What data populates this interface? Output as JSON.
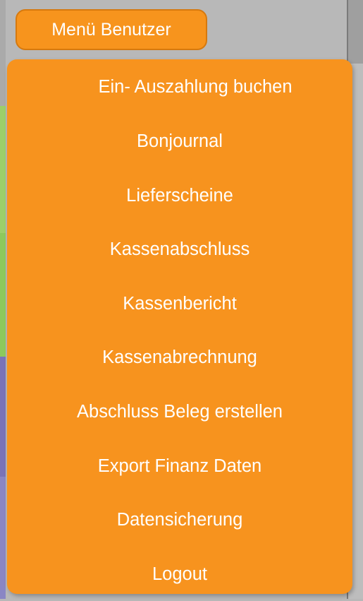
{
  "menu_button": {
    "label": "Menü Benutzer"
  },
  "dropdown": {
    "items": [
      {
        "label": "Ein- Auszahlung buchen"
      },
      {
        "label": "Bonjournal"
      },
      {
        "label": "Lieferscheine"
      },
      {
        "label": "Kassenabschluss"
      },
      {
        "label": "Kassenbericht"
      },
      {
        "label": "Kassenabrechnung"
      },
      {
        "label": "Abschluss Beleg erstellen"
      },
      {
        "label": "Export Finanz Daten"
      },
      {
        "label": "Datensicherung"
      },
      {
        "label": "Logout"
      }
    ]
  },
  "colors": {
    "accent": "#f7941d",
    "text": "#ffffff",
    "background": "#b8b8b8"
  }
}
